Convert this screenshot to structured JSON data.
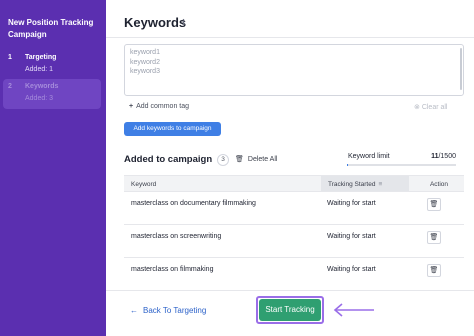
{
  "sidebar": {
    "title": "New Position Tracking Campaign",
    "steps": [
      {
        "num": "1",
        "label": "Targeting",
        "sub": "Added: 1"
      },
      {
        "num": "2",
        "label": "Keywords",
        "sub": "Added: 3"
      }
    ]
  },
  "main": {
    "title": "Keywords",
    "info_icon": "ℹ",
    "keywords_input": [
      "keyword1",
      "keyword2",
      "keyword3"
    ],
    "add_tag_label": "Add common tag",
    "clear_all_label": "Clear all",
    "add_button_label": "Add keywords to campaign",
    "added_section_title": "Added to campaign",
    "added_count": "3",
    "delete_all_label": "Delete All",
    "keyword_limit_label": "Keyword limit",
    "keyword_limit_used": "11",
    "keyword_limit_total": "/1500",
    "keyword_limit_fraction": 0.0073
  },
  "table": {
    "headers": {
      "keyword": "Keyword",
      "status": "Tracking Started",
      "action": "Action"
    },
    "rows": [
      {
        "keyword": "masterclass on documentary filmmaking",
        "status": "Waiting for start"
      },
      {
        "keyword": "masterclass on screenwriting",
        "status": "Waiting for start"
      },
      {
        "keyword": "masterclass on filmmaking",
        "status": "Waiting for start"
      }
    ]
  },
  "footer": {
    "back_label": "Back To Targeting",
    "start_label": "Start Tracking"
  },
  "colors": {
    "sidebar_bg": "#5b2fb0",
    "accent_blue": "#3f7fe5",
    "start_green": "#2f9f71",
    "highlight_purple": "#9a6ee8"
  },
  "icons": {
    "trash": "trash-icon",
    "sort": "sort-icon",
    "back_arrow": "arrow-left-icon",
    "plus": "plus-icon",
    "clear": "clear-icon"
  }
}
